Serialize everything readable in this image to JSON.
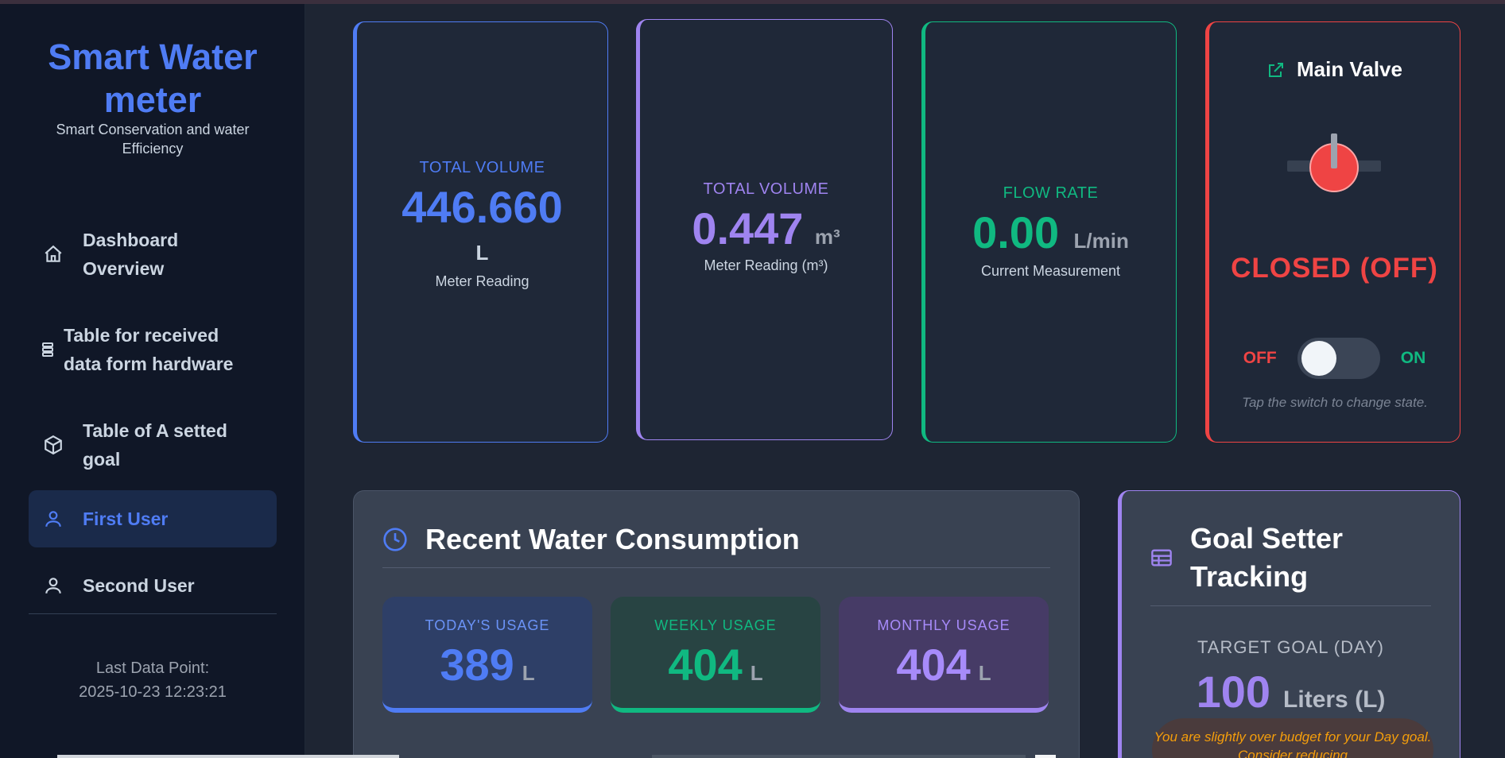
{
  "sidebar": {
    "brand_title": "Smart Water meter",
    "brand_subtitle": "Smart Conservation and water Efficiency",
    "items": [
      {
        "label": "Dashboard Overview",
        "icon": "home-icon"
      },
      {
        "label": "Table for received data form hardware",
        "icon": "database-icon"
      },
      {
        "label": "Table of A setted goal",
        "icon": "box-icon"
      },
      {
        "label": "First User",
        "icon": "user-icon",
        "active": true
      },
      {
        "label": "Second User",
        "icon": "user-icon"
      }
    ],
    "last_data_label": "Last Data Point:",
    "last_data_value": "2025-10-23 12:23:21"
  },
  "cards": {
    "volume_liters": {
      "label": "TOTAL VOLUME",
      "value": "446.660",
      "unit": "L",
      "sub": "Meter Reading",
      "color": "#4f7cf4"
    },
    "volume_m3": {
      "label": "TOTAL VOLUME",
      "value": "0.447",
      "unit": "m³",
      "sub": "Meter Reading (m³)",
      "color": "#9f84f0"
    },
    "flow_rate": {
      "label": "FLOW RATE",
      "value": "0.00",
      "unit": "L/min",
      "sub": "Current Measurement",
      "color": "#10b981"
    }
  },
  "valve": {
    "title": "Main Valve",
    "status": "CLOSED (OFF)",
    "off_label": "OFF",
    "on_label": "ON",
    "is_on": false,
    "hint": "Tap the switch to change state.",
    "color": "#ef4444"
  },
  "consumption": {
    "title": "Recent Water Consumption",
    "today": {
      "label": "TODAY'S USAGE",
      "value": "389",
      "unit": "L"
    },
    "weekly": {
      "label": "WEEKLY USAGE",
      "value": "404",
      "unit": "L"
    },
    "monthly": {
      "label": "MONTHLY USAGE",
      "value": "404",
      "unit": "L"
    }
  },
  "goal": {
    "title": "Goal Setter Tracking",
    "target_label": "TARGET GOAL (DAY)",
    "target_value": "100",
    "target_unit": "Liters (L)",
    "message": "You are slightly over budget for your Day goal. Consider reducing"
  }
}
